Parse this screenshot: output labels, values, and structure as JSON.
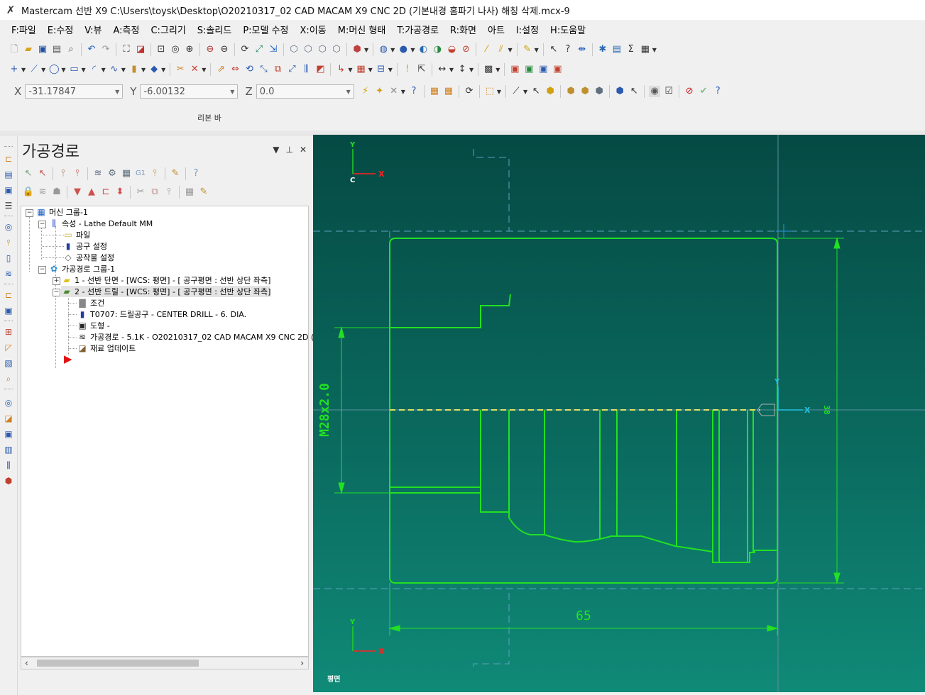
{
  "window": {
    "title": "Mastercam 선반 X9  C:\\Users\\toysk\\Desktop\\O20210317_02 CAD MACAM X9 CNC 2D (기본내경 홈파기 나사) 해칭 삭제.mcx-9"
  },
  "menu": [
    {
      "label": "F:파일"
    },
    {
      "label": "E:수정"
    },
    {
      "label": "V:뷰"
    },
    {
      "label": "A:측정"
    },
    {
      "label": "C:그리기"
    },
    {
      "label": "S:솔리드"
    },
    {
      "label": "P:모델 수정"
    },
    {
      "label": "X:이동"
    },
    {
      "label": "M:머신 형태"
    },
    {
      "label": "T:가공경로"
    },
    {
      "label": "R:화면"
    },
    {
      "label": "아트"
    },
    {
      "label": "I:설정"
    },
    {
      "label": "H:도움말"
    }
  ],
  "coords": {
    "x_label": "X",
    "x_value": "-31.17847",
    "y_label": "Y",
    "y_value": "-6.00132",
    "z_label": "Z",
    "z_value": "0.0"
  },
  "ribbon": {
    "label": "리본 바"
  },
  "panel": {
    "title": "가공경로"
  },
  "tree": {
    "machine_group": "머신 그룹-1",
    "properties": "속성 - Lathe Default MM",
    "files": "파일",
    "tool_settings": "공구 설정",
    "stock_setup": "공작물 설정",
    "toolpath_group": "가공경로 그룹-1",
    "op1": "1 - 선반 단면 - [WCS: 평면] - [  공구평면  : 선반 상단 좌측]",
    "op2": "2 - 선반 드릴 - [WCS: 평면] - [  공구평면  : 선반 상단 좌측]",
    "params": "조건",
    "tool": "T0707: 드릴공구 - CENTER DRILL - 6. DIA.",
    "geometry": "도형 -",
    "toolpath": "가공경로 - 5.1K - O20210317_02 CAD MACAM X9 CNC 2D (기본",
    "stock_update": "재료 업데이트"
  },
  "viewport": {
    "view_name": "평면",
    "axis": {
      "x": "X",
      "y": "Y",
      "c": "C"
    },
    "dims": {
      "diameter": "M28x2.0",
      "length": "65",
      "right": "38"
    },
    "colors": {
      "geometry": "#22e022",
      "axis_x": "#ff2020",
      "axis_y": "#20d020",
      "dim": "#22e022",
      "centerline": "#e0e060"
    }
  }
}
